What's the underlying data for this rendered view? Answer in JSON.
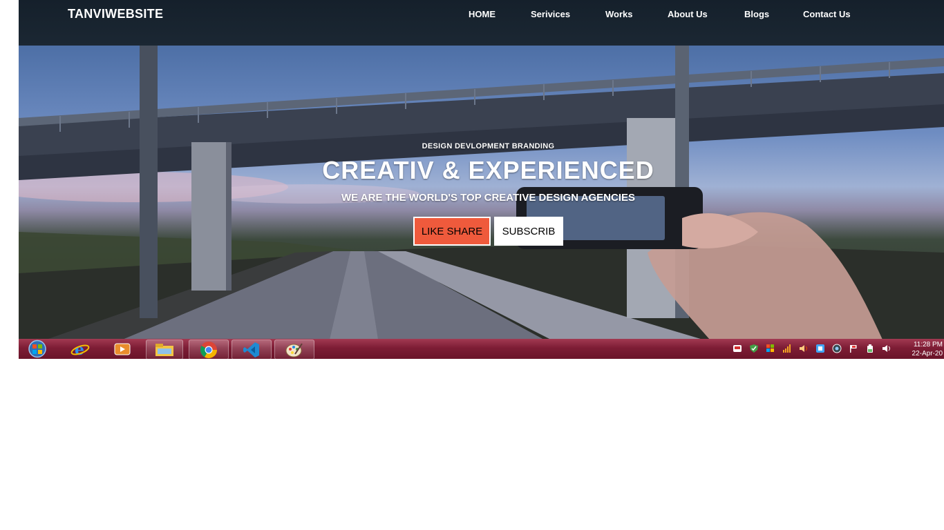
{
  "navbar": {
    "brand": "TANVIWEBSITE",
    "items": [
      {
        "label": "HOME"
      },
      {
        "label": "Serivices"
      },
      {
        "label": "Works"
      },
      {
        "label": "About Us"
      },
      {
        "label": "Blogs"
      },
      {
        "label": "Contact Us"
      }
    ]
  },
  "hero": {
    "tagline": "DESIGN DEVLOPMENT BRANDING",
    "headline": "CREATIV & EXPERIENCED",
    "subheadline": "WE ARE THE WORLD'S TOP CREATIVE DESIGN AGENCIES",
    "buttons": {
      "like_share": "LIKE SHARE",
      "subscribe": "SUBSCRIB"
    },
    "colors": {
      "like_share_bg": "#ef5a3c",
      "subscribe_bg": "#ffffff"
    }
  },
  "taskbar": {
    "apps": [
      "start-orb-icon",
      "internet-explorer-icon",
      "media-player-icon",
      "file-explorer-icon",
      "chrome-icon",
      "vscode-icon",
      "paint-icon"
    ],
    "tray_icons": [
      "tray-app-icon",
      "tray-security-icon",
      "tray-windows-icon",
      "tray-network-icon",
      "tray-audio-icon",
      "tray-app2-icon",
      "tray-sync-icon",
      "tray-flag-icon",
      "tray-battery-icon",
      "volume-icon"
    ],
    "clock": {
      "time": "11:28 PM",
      "date": "22-Apr-20"
    }
  }
}
